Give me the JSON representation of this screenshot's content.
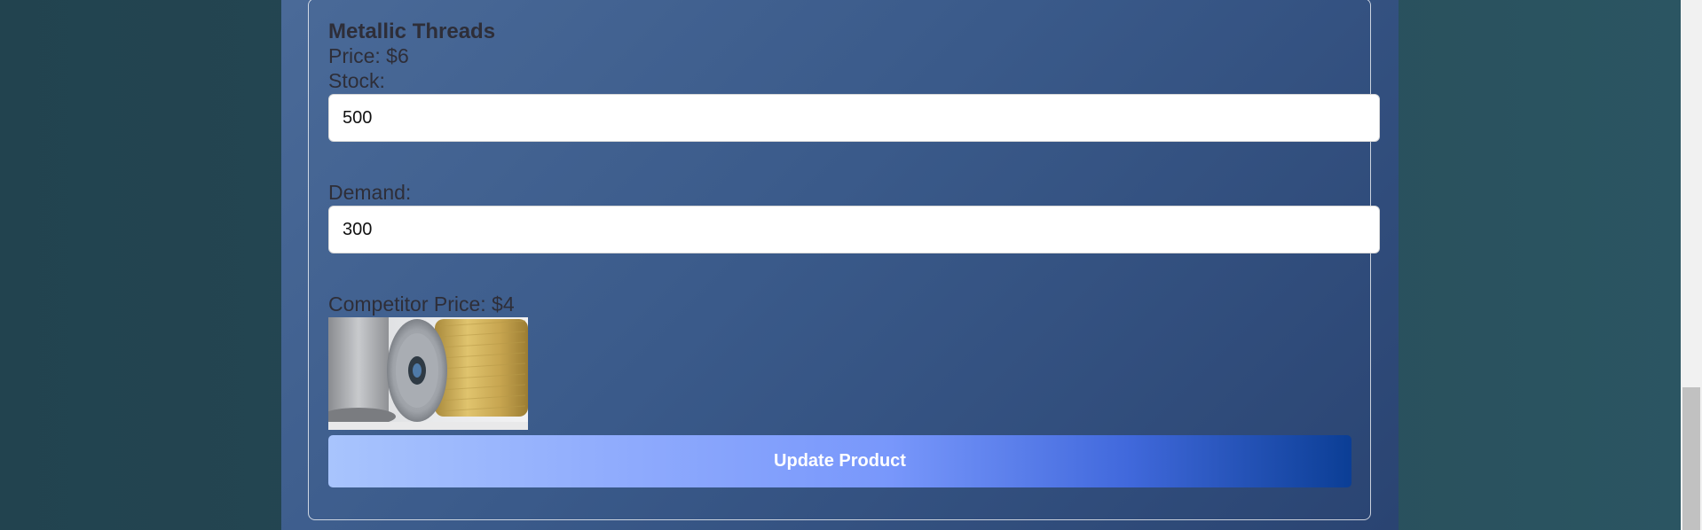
{
  "product": {
    "name": "Metallic Threads",
    "price_text": "Price: $6",
    "stock_label": "Stock:",
    "stock_value": "500",
    "demand_label": "Demand:",
    "demand_value": "300",
    "competitor_price_text": "Competitor Price: $4",
    "update_label": "Update Product"
  },
  "colors": {
    "page_background": "#264a58",
    "panel_gradient_start": "#4a6a98",
    "panel_gradient_end": "#2a4472",
    "button_gradient_start": "#a8c4fd",
    "button_gradient_end": "#0b3e95",
    "label_text": "#2e2e38"
  },
  "scroll": {
    "position_fraction": 0.73
  }
}
